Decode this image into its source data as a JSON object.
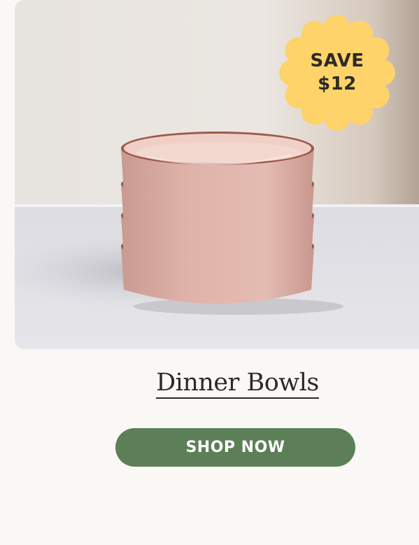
{
  "promo": {
    "badge": {
      "line1": "SAVE",
      "line2": "$12",
      "color": "#fdd36a"
    }
  },
  "product": {
    "name": "Dinner Bowls",
    "image_subject": "stacked-pink-dinner-bowls"
  },
  "cta": {
    "label": "SHOP NOW",
    "color": "#5c7f57"
  }
}
